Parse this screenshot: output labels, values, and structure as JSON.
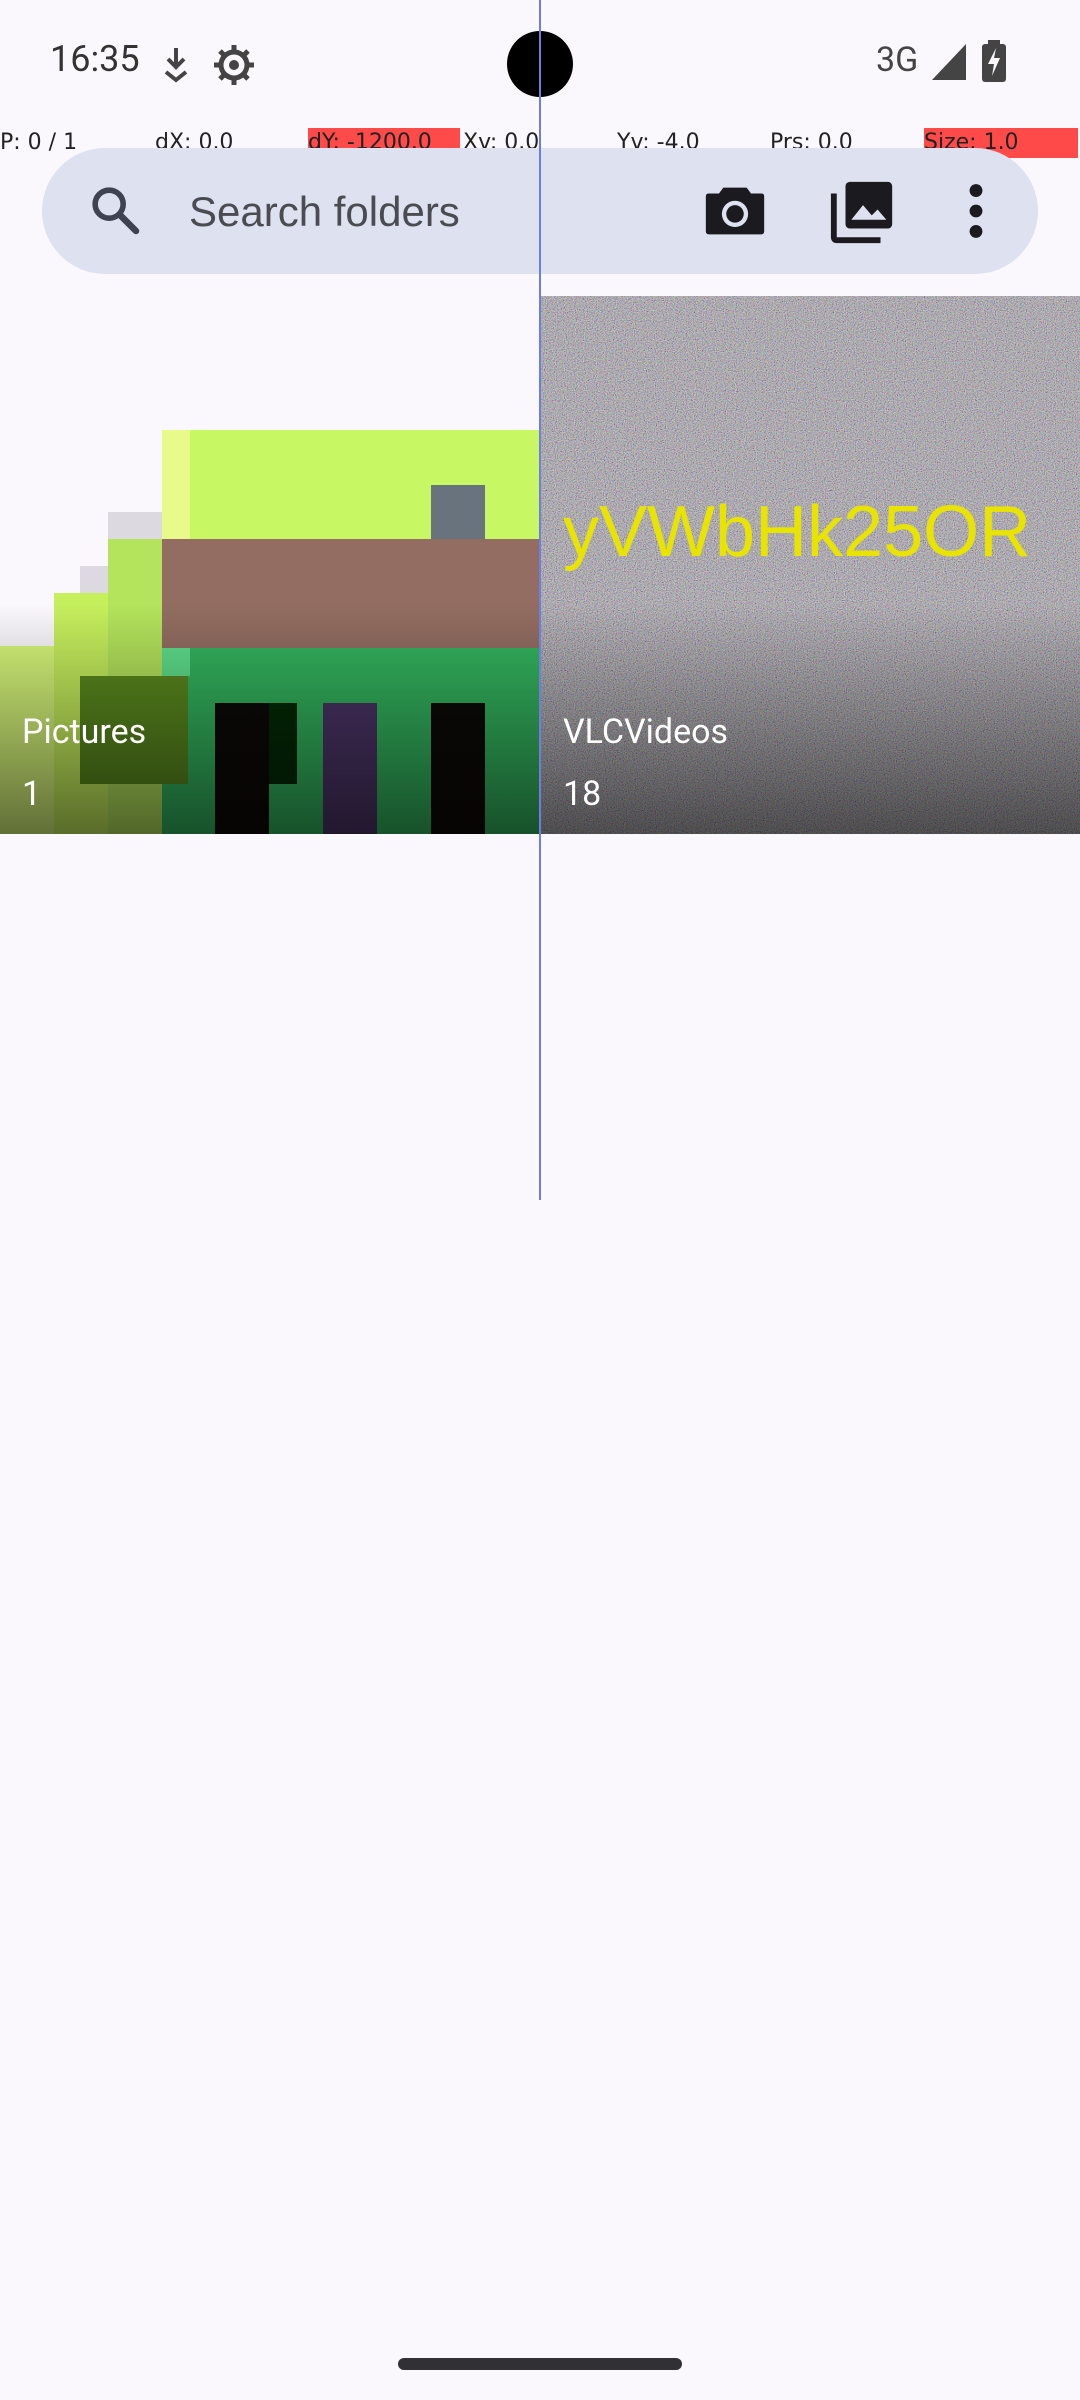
{
  "status_bar": {
    "time": "16:35",
    "network": "3G",
    "icons": [
      "download-notification-icon",
      "settings-gear-icon",
      "signal-icon",
      "battery-charging-icon"
    ]
  },
  "pointer_overlay": {
    "p": "P: 0 / 1",
    "dx": "dX: 0.0",
    "dy": "dY: -1200.0",
    "xv": "Xv: 0.0",
    "yv": "Yv: -4.0",
    "prs": "Prs: 0.0",
    "size": "Size: 1.0"
  },
  "search": {
    "placeholder": "Search folders",
    "icons": [
      "search-icon",
      "camera-icon",
      "gallery-icon",
      "more-vert-icon"
    ]
  },
  "folders": [
    {
      "name": "Pictures",
      "count": "1"
    },
    {
      "name": "VLCVideos",
      "count": "18",
      "thumbnail_text": "yVWbHk25OR"
    }
  ],
  "colors": {
    "background": "#fbf8fd",
    "search_bar": "#dde1f0",
    "overlay_red": "#ff4a4a",
    "pointer_line": "#6a7fe0"
  }
}
